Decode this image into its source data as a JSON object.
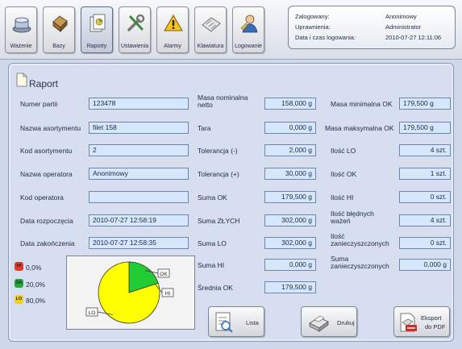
{
  "toolbar": {
    "buttons": [
      {
        "label": "Ważenie",
        "icon": "scale-icon"
      },
      {
        "label": "Bazy",
        "icon": "database-icon"
      },
      {
        "label": "Raporty",
        "icon": "report-icon",
        "active": true
      },
      {
        "label": "Ustawienia",
        "icon": "tools-icon"
      },
      {
        "label": "Alarmy",
        "icon": "warning-icon"
      },
      {
        "label": "Klawiatura",
        "icon": "keyboard-icon"
      },
      {
        "label": "Logowanie",
        "icon": "login-icon"
      }
    ]
  },
  "session": {
    "logged_label": "Zalogowany:",
    "logged_value": "Anonimowy",
    "rights_label": "Uprawnienia:",
    "rights_value": "Administrator",
    "time_label": "Data i czas logowania:",
    "time_value": "2010-07-27 12:11:06"
  },
  "report": {
    "title": "Raport",
    "left": [
      {
        "label": "Numer partii",
        "value": "123478"
      },
      {
        "label": "Nazwa asortymentu",
        "value": "filet 158"
      },
      {
        "label": "Kod asortymentu",
        "value": "2"
      },
      {
        "label": "Nazwa operatora",
        "value": "Anonimowy"
      },
      {
        "label": "Kod operatora",
        "value": ""
      },
      {
        "label": "Data rozpoczęcia",
        "value": "2010-07-27 12:58:19"
      },
      {
        "label": "Data zakończenia",
        "value": "2010-07-27 12:58:35"
      }
    ],
    "middle": [
      {
        "label": "Masa nominalna netto",
        "value": "158,000 g"
      },
      {
        "label": "Tara",
        "value": "0,000 g"
      },
      {
        "label": "Tolerancja (-)",
        "value": "2,000 g"
      },
      {
        "label": "Tolerancja (+)",
        "value": "30,000 g"
      },
      {
        "label": "Suma OK",
        "value": "179,500 g"
      },
      {
        "label": "Suma ZŁYCH",
        "value": "302,000 g"
      },
      {
        "label": "Suma LO",
        "value": "302,000 g"
      },
      {
        "label": "Suma HI",
        "value": "0,000 g"
      },
      {
        "label": "Średnia OK",
        "value": "179,500 g"
      }
    ],
    "right": [
      {
        "label": "Masa minimalna OK",
        "value": "179,500 g"
      },
      {
        "label": "Masa maksymalna OK",
        "value": "179,500 g"
      },
      {
        "label": "Ilość LO",
        "value": "4 szt."
      },
      {
        "label": "Ilość OK",
        "value": "1 szt."
      },
      {
        "label": "Ilość HI",
        "value": "0 szt."
      },
      {
        "label": "Ilość błędnych ważeń",
        "value": "4 szt."
      },
      {
        "label": "Ilość zanieczyszczonych",
        "value": "0 szt."
      },
      {
        "label": "Suma zanieczyszczonych",
        "value": "0,000 g"
      }
    ]
  },
  "stats": [
    {
      "badge": "HI",
      "value": "0,0%",
      "color": "#e03a2a"
    },
    {
      "badge": "OK",
      "value": "20,0%",
      "color": "#22a83a"
    },
    {
      "badge": "LO",
      "value": "80,0%",
      "color": "#f0d020"
    }
  ],
  "chart_data": {
    "type": "pie",
    "categories": [
      "LO",
      "OK",
      "HI"
    ],
    "values": [
      80,
      20,
      0
    ],
    "colors": [
      "#ffff00",
      "#22cc33",
      "#e03a2a"
    ]
  },
  "actions": {
    "list_label": "Lista",
    "print_label": "Drukuj",
    "export_label_1": "Eksport",
    "export_label_2": "do PDF"
  }
}
